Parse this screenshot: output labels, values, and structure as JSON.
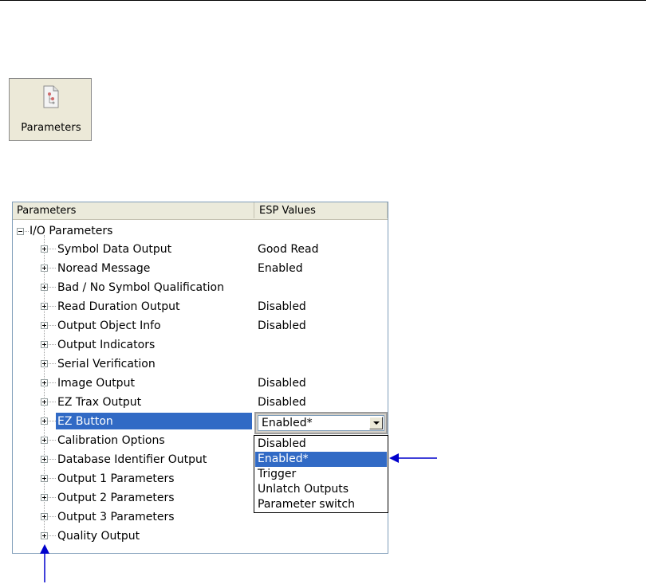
{
  "toolbar": {
    "parameters_label": "Parameters",
    "parameters_icon": "parameters-document-icon"
  },
  "tree": {
    "header": {
      "col1": "Parameters",
      "col2": "ESP Values"
    },
    "root": {
      "label": "I/O Parameters",
      "expanded": true
    },
    "items": [
      {
        "name": "Symbol Data Output",
        "value": "Good Read"
      },
      {
        "name": "Noread Message",
        "value": "Enabled"
      },
      {
        "name": "Bad / No Symbol Qualification",
        "value": ""
      },
      {
        "name": "Read Duration Output",
        "value": "Disabled"
      },
      {
        "name": "Output Object Info",
        "value": "Disabled"
      },
      {
        "name": "Output Indicators",
        "value": ""
      },
      {
        "name": "Serial Verification",
        "value": ""
      },
      {
        "name": "Image Output",
        "value": "Disabled"
      },
      {
        "name": "EZ Trax Output",
        "value": "Disabled"
      },
      {
        "name": "EZ Button",
        "value": "",
        "selected": true
      },
      {
        "name": "Calibration Options",
        "value": ""
      },
      {
        "name": "Database Identifier Output",
        "value": ""
      },
      {
        "name": "Output 1 Parameters",
        "value": ""
      },
      {
        "name": "Output 2 Parameters",
        "value": ""
      },
      {
        "name": "Output 3 Parameters",
        "value": ""
      },
      {
        "name": "Quality Output",
        "value": ""
      }
    ]
  },
  "combo": {
    "value": "Enabled*",
    "options": [
      "Disabled",
      "Enabled*",
      "Trigger",
      "Unlatch Outputs",
      "Parameter switch"
    ],
    "highlighted_option": "Enabled*"
  },
  "colors": {
    "selection": "#316ac5",
    "annotation_arrow": "#0000cc",
    "header_bg": "#ebeadb"
  }
}
